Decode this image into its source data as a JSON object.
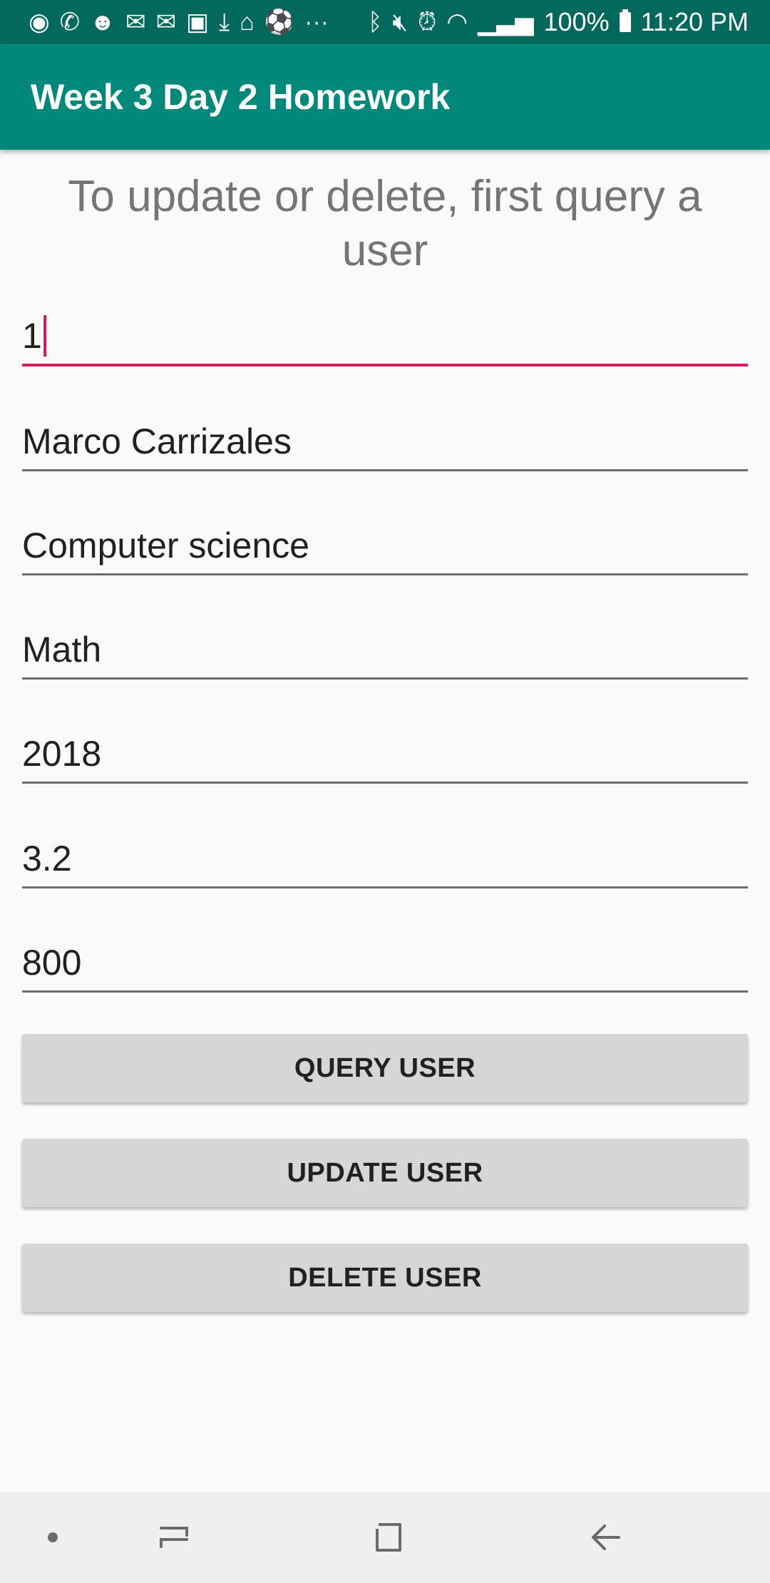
{
  "status_bar": {
    "battery_percent": "100%",
    "time": "11:20 PM",
    "icons": [
      "spotify-icon",
      "whatsapp-icon",
      "reddit-icon",
      "gmail-icon",
      "gmail-icon",
      "twitch-icon",
      "download-icon",
      "amazon-icon",
      "soccer-icon",
      "more-icon",
      "bluetooth-icon",
      "mute-icon",
      "alarm-icon",
      "wifi-icon",
      "signal-icon",
      "battery-icon"
    ]
  },
  "app_bar": {
    "title": "Week 3 Day 2 Homework"
  },
  "form": {
    "instruction": "To update or delete, first query a user",
    "fields": [
      {
        "value": "1"
      },
      {
        "value": "Marco Carrizales"
      },
      {
        "value": "Computer science"
      },
      {
        "value": "Math"
      },
      {
        "value": "2018"
      },
      {
        "value": "3.2"
      },
      {
        "value": "800"
      }
    ]
  },
  "buttons": {
    "query": "QUERY USER",
    "update": "UPDATE USER",
    "delete": "DELETE USER"
  },
  "colors": {
    "status_bar": "#00695c",
    "app_bar": "#00897b",
    "accent": "#d81b60",
    "button": "#d6d6d6"
  }
}
